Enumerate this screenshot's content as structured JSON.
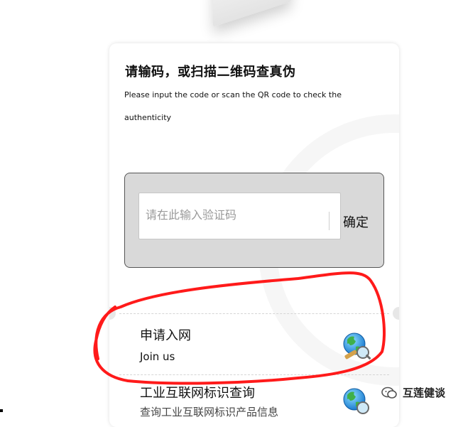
{
  "header": {
    "title": "请输码，或扫描二维码查真伪",
    "subtitle": "Please input the code or scan the QR code to check the authenticity"
  },
  "verify": {
    "placeholder": "请在此输入验证码",
    "confirm_label": "确定"
  },
  "options": [
    {
      "title": "申请入网",
      "subtitle": "Join us",
      "icon": "globe-search-icon"
    },
    {
      "title": "工业互联网标识查询",
      "subtitle": "查询工业互联网标识产品信息",
      "icon": "globe-search-icon"
    }
  ],
  "watermark": {
    "brand": "互莲健谈",
    "icon": "wechat-icon"
  },
  "colors": {
    "annotation": "#ff1a1a",
    "panel": "#d9d9d9"
  }
}
